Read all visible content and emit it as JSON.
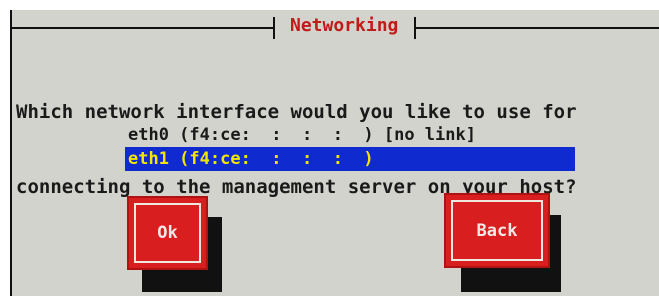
{
  "dialog": {
    "title": "Networking",
    "prompt_lines": [
      "Which network interface would you like to use for",
      "connecting to the management server on your host?"
    ]
  },
  "interfaces": [
    {
      "label": "eth0 (f4:ce:  :  :  :  ) [no link]",
      "selected": false
    },
    {
      "label": "eth1 (f4:ce:  :  :  :  )",
      "selected": true
    }
  ],
  "buttons": {
    "ok_label": "Ok",
    "back_label": "Back"
  },
  "colors": {
    "background": "#d3d3cd",
    "title_text": "#c21a17",
    "selection_bg": "#0f2bd0",
    "selection_text": "#f2e600",
    "button_bg": "#d81e1e"
  }
}
